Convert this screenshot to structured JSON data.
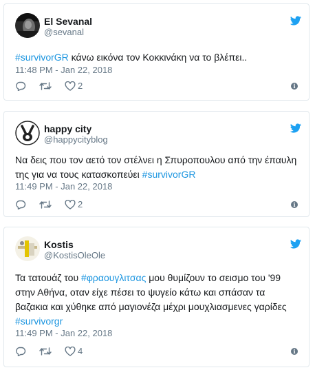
{
  "colors": {
    "hashtag": "#1b95e0",
    "twitter_blue": "#1da1f2",
    "muted": "#657786",
    "border": "#e1e8ed"
  },
  "tweets": [
    {
      "name": "El Sevanal",
      "handle": "@sevanal",
      "segments": [
        {
          "text": "#survivorGR",
          "hashtag": true
        },
        {
          "text": " κάνω εικόνα τον Κοκκινάκη να το βλέπει..",
          "hashtag": false
        }
      ],
      "time": "11:48 PM - Jan 22, 2018",
      "likes": "2",
      "icons": {
        "reply": "reply-icon",
        "retweet": "retweet-icon",
        "like": "heart-icon",
        "info": "info-icon",
        "brand": "twitter-bird-icon"
      }
    },
    {
      "name": "happy city",
      "handle": "@happycityblog",
      "segments": [
        {
          "text": "Να δεις που τον αετό τον στέλνει η Σπυροπουλου από την έπαυλη της για να τους κατασκοπεύει ",
          "hashtag": false
        },
        {
          "text": "#survivorGR",
          "hashtag": true
        }
      ],
      "time": "11:49 PM - Jan 22, 2018",
      "likes": "2",
      "icons": {
        "reply": "reply-icon",
        "retweet": "retweet-icon",
        "like": "heart-icon",
        "info": "info-icon",
        "brand": "twitter-bird-icon"
      }
    },
    {
      "name": "Kostis",
      "handle": "@KostisOleOle",
      "segments": [
        {
          "text": "Τα τατουάζ του ",
          "hashtag": false
        },
        {
          "text": "#φραουγλιτσας",
          "hashtag": true
        },
        {
          "text": " μου θυμίζουν το σεισμο του '99 στην Αθήνα, οταν είχε πέσει το ψυγείο κάτω και σπάσαν τα βαζακια και χύθηκε από μαγιονέζα μέχρι μουχλιασμενες γαρίδες ",
          "hashtag": false
        },
        {
          "text": "#survivorgr",
          "hashtag": true
        }
      ],
      "time": "11:49 PM - Jan 22, 2018",
      "likes": "4",
      "icons": {
        "reply": "reply-icon",
        "retweet": "retweet-icon",
        "like": "heart-icon",
        "info": "info-icon",
        "brand": "twitter-bird-icon"
      }
    }
  ]
}
